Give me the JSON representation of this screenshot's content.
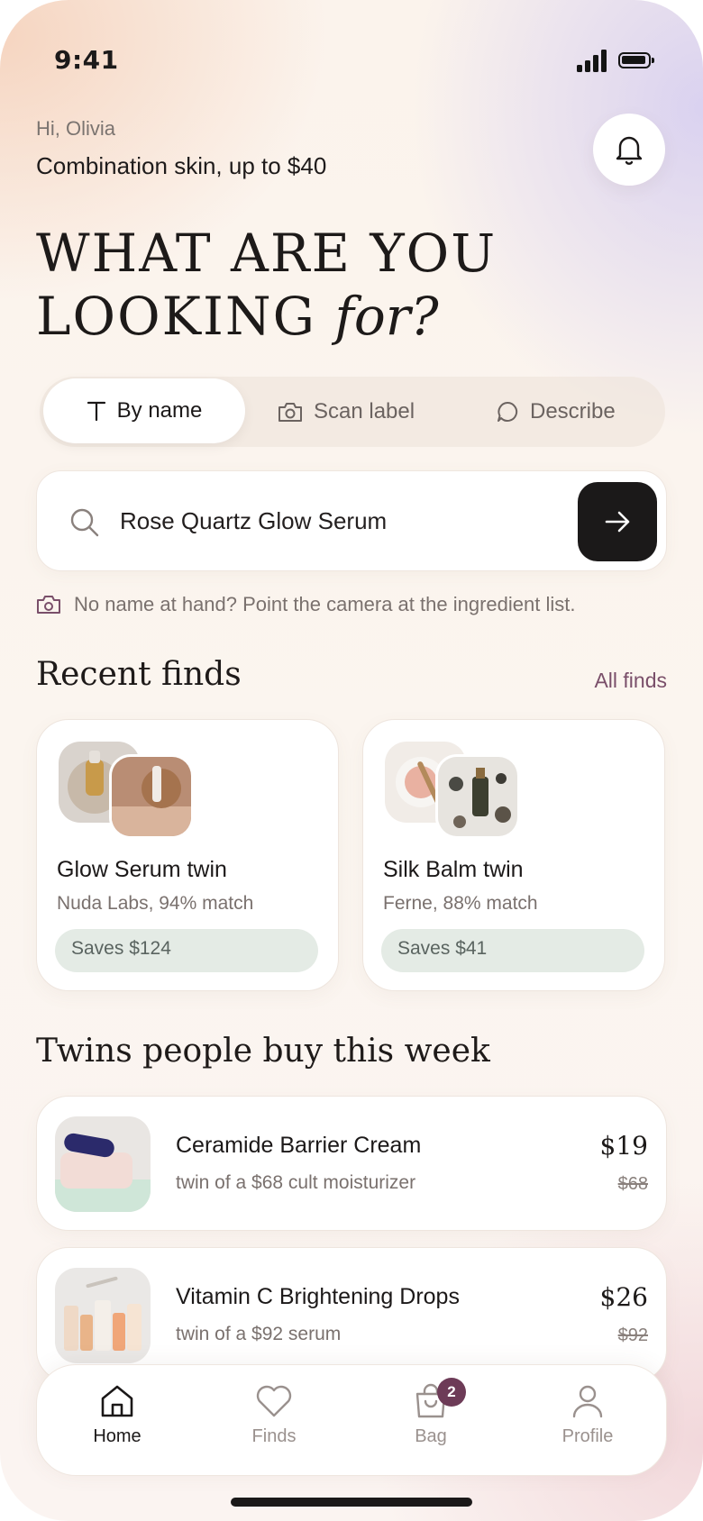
{
  "status": {
    "time": "9:41"
  },
  "header": {
    "greeting": "Hi, Olivia",
    "profile_summary": "Combination skin, up to $40",
    "headline_line1": "WHAT ARE YOU",
    "headline_line2_main": "LOOKING ",
    "headline_line2_italic": "for?"
  },
  "search_modes": {
    "tabs": [
      {
        "label": "By name",
        "icon": "text-icon",
        "selected": true
      },
      {
        "label": "Scan label",
        "icon": "camera-icon",
        "selected": false
      },
      {
        "label": "Describe",
        "icon": "speech-bubble-icon",
        "selected": false
      }
    ]
  },
  "search": {
    "value": "Rose Quartz Glow Serum",
    "submit_icon": "arrow-right-icon"
  },
  "hint": {
    "text": "No name at hand? Point the camera at the ingredient list.",
    "icon": "camera-icon"
  },
  "recent": {
    "title": "Recent finds",
    "link": "All finds",
    "cards": [
      {
        "name": "Glow Serum twin",
        "sub": "Nuda Labs, 94% match",
        "saves": "Saves $124"
      },
      {
        "name": "Silk Balm twin",
        "sub": "Ferne, 88% match",
        "saves": "Saves $41"
      }
    ]
  },
  "trending": {
    "title": "Twins people buy this week",
    "items": [
      {
        "name": "Ceramide Barrier Cream",
        "sub": "twin of a $68 cult moisturizer",
        "price": "$19",
        "old_price": "$68"
      },
      {
        "name": "Vitamin C Brightening Drops",
        "sub": "twin of a $92 serum",
        "price": "$26",
        "old_price": "$92"
      }
    ]
  },
  "tabbar": {
    "items": [
      {
        "label": "Home",
        "icon": "home-icon",
        "active": true
      },
      {
        "label": "Finds",
        "icon": "heart-icon",
        "active": false
      },
      {
        "label": "Bag",
        "icon": "shopping-bag-icon",
        "active": false,
        "badge": "2"
      },
      {
        "label": "Profile",
        "icon": "person-icon",
        "active": false
      }
    ]
  },
  "colors": {
    "accent_plum": "#6d3b57",
    "link": "#7a4f6a",
    "saves_pill": "#e4ebe5",
    "dark_button": "#1b1919"
  }
}
